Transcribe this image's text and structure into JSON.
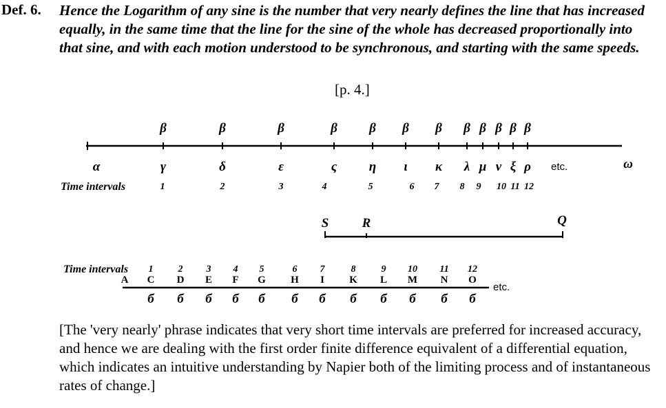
{
  "definition": {
    "label": "Def. 6.",
    "text": "Hence the Logarithm of any sine is the number that very nearly defines the line that has increased equally, in the same time that the line for the sine of the whole has decreased proportionally into that sine,  and with each motion understood to be synchronous, and starting with the same speeds."
  },
  "page_ref": "[p. 4.]",
  "top_line": {
    "start_label": "α",
    "end_label": "ω",
    "beta_symbol": "β",
    "point_labels": [
      "γ",
      "δ",
      "ε",
      "ς",
      "η",
      "ι",
      "κ",
      "λ",
      "μ",
      "ν",
      "ξ",
      "ρ"
    ],
    "etc": "etc.",
    "time_label": "Time intervals",
    "interval_numbers": [
      "1",
      "2",
      "3",
      "4",
      "5",
      "6",
      "7",
      "8",
      "9",
      "10",
      "11",
      "12"
    ]
  },
  "segment": {
    "labels": [
      "S",
      "R",
      "Q"
    ]
  },
  "bottom_line": {
    "time_label": "Time intervals",
    "interval_numbers": [
      "1",
      "2",
      "3",
      "4",
      "5",
      "6",
      "7",
      "8",
      "9",
      "10",
      "11",
      "12"
    ],
    "start_label": "A",
    "point_labels": [
      "C",
      "D",
      "E",
      "F",
      "G",
      "H",
      "I",
      "K",
      "L",
      "M",
      "N",
      "O"
    ],
    "below_symbol": "б",
    "etc": "etc."
  },
  "note": "[The 'very nearly' phrase indicates that very short time intervals are preferred for increased accuracy, and hence we are dealing with the first order finite difference equivalent of a differential equation, which indicates an intuitive understanding by Napier both of the limiting process and of instantaneous rates of change.]"
}
